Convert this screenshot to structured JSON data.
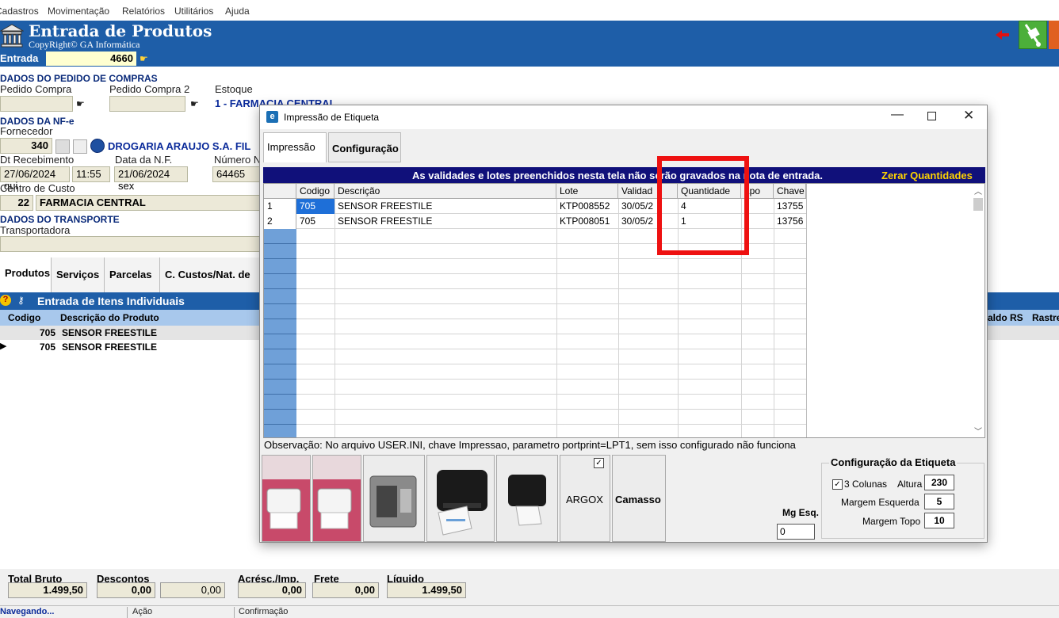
{
  "menu": {
    "items": [
      "Cadastros",
      "Movimentação",
      "Relatórios",
      "Utilitários",
      "Ajuda"
    ]
  },
  "window": {
    "title": "Entrada de Produtos",
    "copyright": "CopyRight© GA Informática"
  },
  "entrada": {
    "label": "Entrada",
    "value": "4660"
  },
  "pedido": {
    "section": "DADOS DO PEDIDO DE COMPRAS",
    "pedido_compra_label": "Pedido Compra",
    "pedido_compra_2_label": "Pedido Compra 2",
    "estoque_label": "Estoque",
    "estoque_value": "1 - FARMACIA CENTRAL"
  },
  "nfe": {
    "section": "DADOS DA NF-e",
    "fornecedor_label": "Fornecedor",
    "fornecedor_code": "340",
    "fornecedor_name": "DROGARIA ARAUJO S.A. FIL",
    "dt_recebimento_label": "Dt Recebimento",
    "dt_recebimento": "27/06/2024 qui",
    "hora": "11:55",
    "data_nf_label": "Data da N.F.",
    "data_nf": "21/06/2024 sex",
    "numero_label": "Número N",
    "numero": "64465",
    "centro_custo_label": "Centro de Custo",
    "centro_custo_code": "22",
    "centro_custo_name": "FARMACIA CENTRAL"
  },
  "transporte": {
    "section": "DADOS DO TRANSPORTE",
    "transportadora_label": "Transportadora"
  },
  "main_tabs": [
    "Produtos",
    "Serviços",
    "Parcelas",
    "C. Custos/Nat. de"
  ],
  "itens": {
    "title": "Entrada de Itens Individuais",
    "columns": [
      "Codigo",
      "Descrição do Produto"
    ],
    "right_columns": [
      "aldo RS",
      "Rastre"
    ],
    "rows": [
      {
        "codigo": "705",
        "descricao": "SENSOR FREESTILE"
      },
      {
        "codigo": "705",
        "descricao": "SENSOR FREESTILE"
      }
    ]
  },
  "dialog": {
    "title": "Impressão de Etiqueta",
    "tabs": [
      "Impressão",
      "Configuração"
    ],
    "banner": "As validades e lotes preenchidos nesta tela não serão gravados na nota de entrada.",
    "zerar": "Zerar Quantidades",
    "columns": [
      "Codigo",
      "Descrição",
      "Lote",
      "Validad",
      "Quantidade",
      "Lpo",
      "Chave"
    ],
    "rows": [
      {
        "n": "1",
        "codigo": "705",
        "descricao": "SENSOR FREESTILE",
        "lote": "KTP008552",
        "validade": "30/05/2",
        "quantidade": "4",
        "lpo": "",
        "chave": "13755"
      },
      {
        "n": "2",
        "codigo": "705",
        "descricao": "SENSOR FREESTILE",
        "lote": "KTP008051",
        "validade": "30/05/2",
        "quantidade": "1",
        "lpo": "",
        "chave": "13756"
      }
    ],
    "observacao": "Observação: No arquivo USER.INI, chave Impressao, parametro portprint=LPT1, sem isso configurado não funciona",
    "printer_buttons": [
      "ARGOX",
      "Camasso"
    ],
    "mg_esq_label": "Mg Esq.",
    "mg_esq_value": "0",
    "config": {
      "title": "Configuração da Etiqueta",
      "tres_colunas": "3 Colunas",
      "altura_label": "Altura",
      "altura": "230",
      "margem_esquerda_label": "Margem Esquerda",
      "margem_esquerda": "5",
      "margem_topo_label": "Margem Topo",
      "margem_topo": "10"
    }
  },
  "totals": {
    "total_bruto_label": "Total Bruto",
    "total_bruto": "1.499,50",
    "descontos_label": "Descontos",
    "descontos": "0,00",
    "descontos2": "0,00",
    "acresc_label": "Acrésc./Imp.",
    "acresc": "0,00",
    "frete_label": "Frete",
    "frete": "0,00",
    "liquido_label": "Líquido",
    "liquido": "1.499,50"
  },
  "statusbar": [
    "Navegando...",
    "Ação",
    "Confirmação"
  ],
  "colors": {
    "title_blue": "#1e5ea8",
    "banner_navy": "#10107a",
    "highlight_red": "#ee1111"
  }
}
